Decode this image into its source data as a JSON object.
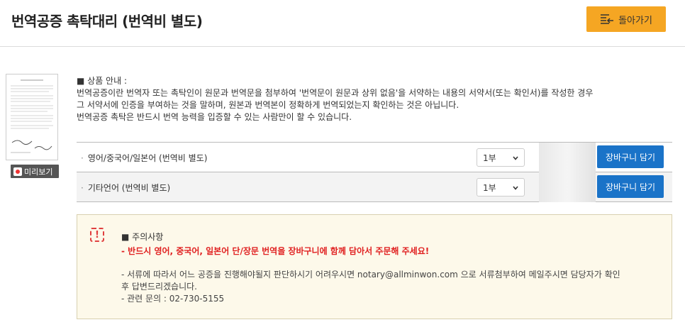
{
  "header": {
    "title": "번역공증 촉탁대리 (번역비 별도)",
    "back_label": "돌아가기"
  },
  "preview": {
    "label": "미리보기"
  },
  "info": {
    "heading": "■ 상품 안내 :",
    "lines": [
      "번역공증이란 번역자 또는 촉탁인이 원문과 번역문을 첨부하여 '번역문이 원문과 상위 없음'을 서약하는 내용의 서약서(또는 확인서)를 작성한 경우",
      "그 서약서에 인증을 부여하는 것을 말하며, 원본과 번역본이 정확하게 번역되었는지 확인하는 것은 아닙니다.",
      "번역공증 촉탁은 반드시 번역 능력을 입증할 수 있는 사람만이 할 수 있습니다."
    ]
  },
  "options": [
    {
      "name": "영어/중국어/일본어 (번역비 별도)",
      "qty": "1부",
      "button": "장바구니 담기"
    },
    {
      "name": "기타언어 (번역비 별도)",
      "qty": "1부",
      "button": "장바구니 담기"
    }
  ],
  "notice": {
    "icon_text": "!",
    "title": "■ 주의사항",
    "warning": "- 반드시 영어, 중국어, 일본어 단/장문 번역을 장바구니에 함께 담아서 주문해 주세요!",
    "body": [
      "- 서류에 따라서 어느 공증을 진행해야될지 판단하시기 어려우시면 notary@allminwon.com 으로 서류첨부하여 메일주시면 담당자가 확인",
      "후 답변드리겠습니다.",
      "- 관련 문의 : 02-730-5155"
    ]
  },
  "colors": {
    "back_button": "#f5a623",
    "cart_button": "#1a73c8",
    "warning_text": "#e02020",
    "notice_bg": "#fdf9ea"
  },
  "icons": {
    "back": "list-arrow-back-icon",
    "preview": "preview-icon",
    "select": "chevron-down-icon",
    "warning": "exclamation-icon"
  }
}
